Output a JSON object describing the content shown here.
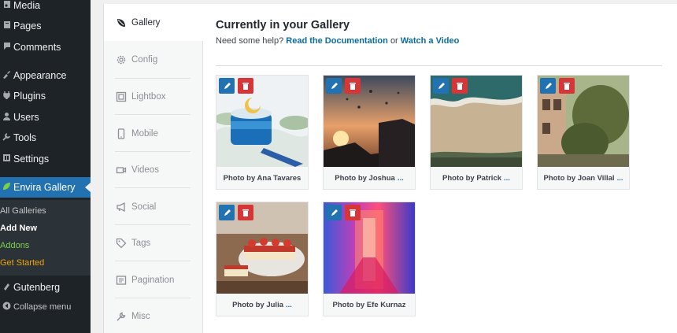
{
  "wp_menu": {
    "items": [
      {
        "label": "Media",
        "icon": "media-icon"
      },
      {
        "label": "Pages",
        "icon": "pages-icon"
      },
      {
        "label": "Comments",
        "icon": "comments-icon"
      },
      {
        "label": "Appearance",
        "icon": "appearance-icon"
      },
      {
        "label": "Plugins",
        "icon": "plugins-icon"
      },
      {
        "label": "Users",
        "icon": "users-icon"
      },
      {
        "label": "Tools",
        "icon": "tools-icon"
      },
      {
        "label": "Settings",
        "icon": "settings-icon"
      },
      {
        "label": "Envira Gallery",
        "icon": "envira-leaf-icon"
      },
      {
        "label": "Gutenberg",
        "icon": "gutenberg-icon"
      },
      {
        "label": "Collapse menu",
        "icon": "collapse-icon"
      }
    ],
    "submenu": [
      {
        "label": "All Galleries",
        "color": "#c3c4c7"
      },
      {
        "label": "Add New",
        "color": "#ffffff"
      },
      {
        "label": "Addons",
        "color": "#7bd04a"
      },
      {
        "label": "Get Started",
        "color": "#f0a30a"
      }
    ]
  },
  "tabs": [
    {
      "label": "Gallery",
      "icon": "leaf-icon",
      "active": true
    },
    {
      "label": "Config",
      "icon": "gear-icon"
    },
    {
      "label": "Lightbox",
      "icon": "lightbox-icon"
    },
    {
      "label": "Mobile",
      "icon": "mobile-icon"
    },
    {
      "label": "Videos",
      "icon": "video-icon"
    },
    {
      "label": "Social",
      "icon": "megaphone-icon"
    },
    {
      "label": "Tags",
      "icon": "tag-icon"
    },
    {
      "label": "Pagination",
      "icon": "pagination-icon"
    },
    {
      "label": "Misc",
      "icon": "wrench-icon"
    }
  ],
  "gallery": {
    "title": "Currently in your Gallery",
    "help_prefix": "Need some help?",
    "doc_link": "Read the Documentation",
    "or_text": "or",
    "video_link": "Watch a Video",
    "images": [
      {
        "caption": "Photo by Ana Tavares",
        "truncated": false
      },
      {
        "caption": "Photo by Joshua",
        "truncated": true
      },
      {
        "caption": "Photo by Patrick",
        "truncated": true
      },
      {
        "caption": "Photo by Joan Villal",
        "truncated": true
      },
      {
        "caption": "Photo by Julia",
        "truncated": true
      },
      {
        "caption": "Photo by Efe Kurnaz",
        "truncated": false
      }
    ],
    "ellipsis": "..."
  },
  "colors": {
    "accent": "#2271b1",
    "delete": "#d63638",
    "link": "#0a6ca0"
  }
}
